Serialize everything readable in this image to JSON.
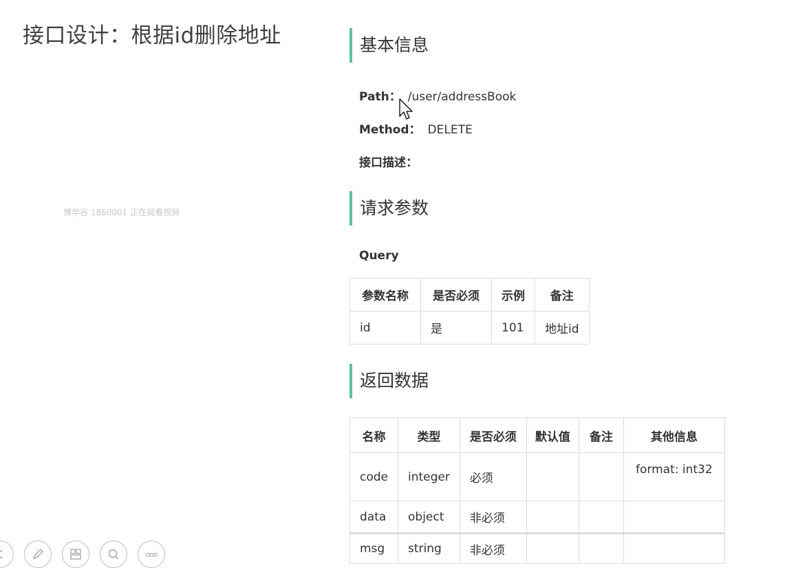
{
  "slide": {
    "title": "接口设计：根据id删除地址"
  },
  "watermark": "博学谷 1860001 正在观看视频",
  "basic_info": {
    "heading": "基本信息",
    "path_label": "Path：",
    "path_value": "/user/addressBook",
    "method_label": "Method：",
    "method_value": "DELETE",
    "desc_label": "接口描述："
  },
  "request": {
    "heading": "请求参数",
    "query_label": "Query",
    "columns": [
      "参数名称",
      "是否必须",
      "示例",
      "备注"
    ],
    "rows": [
      [
        "id",
        "是",
        "101",
        "地址id"
      ]
    ]
  },
  "response": {
    "heading": "返回数据",
    "columns": [
      "名称",
      "类型",
      "是否必须",
      "默认值",
      "备注",
      "其他信息"
    ],
    "rows": [
      [
        "code",
        "integer",
        "必须",
        "",
        "",
        "format: int32"
      ],
      [
        "data",
        "object",
        "非必须",
        "",
        "",
        ""
      ],
      [
        "msg",
        "string",
        "非必须",
        "",
        "",
        ""
      ]
    ]
  },
  "toolbar": {
    "icons": [
      "back-icon",
      "pen-icon",
      "layout-icon",
      "zoom-icon",
      "more-icon"
    ],
    "more_label": "ooo"
  }
}
